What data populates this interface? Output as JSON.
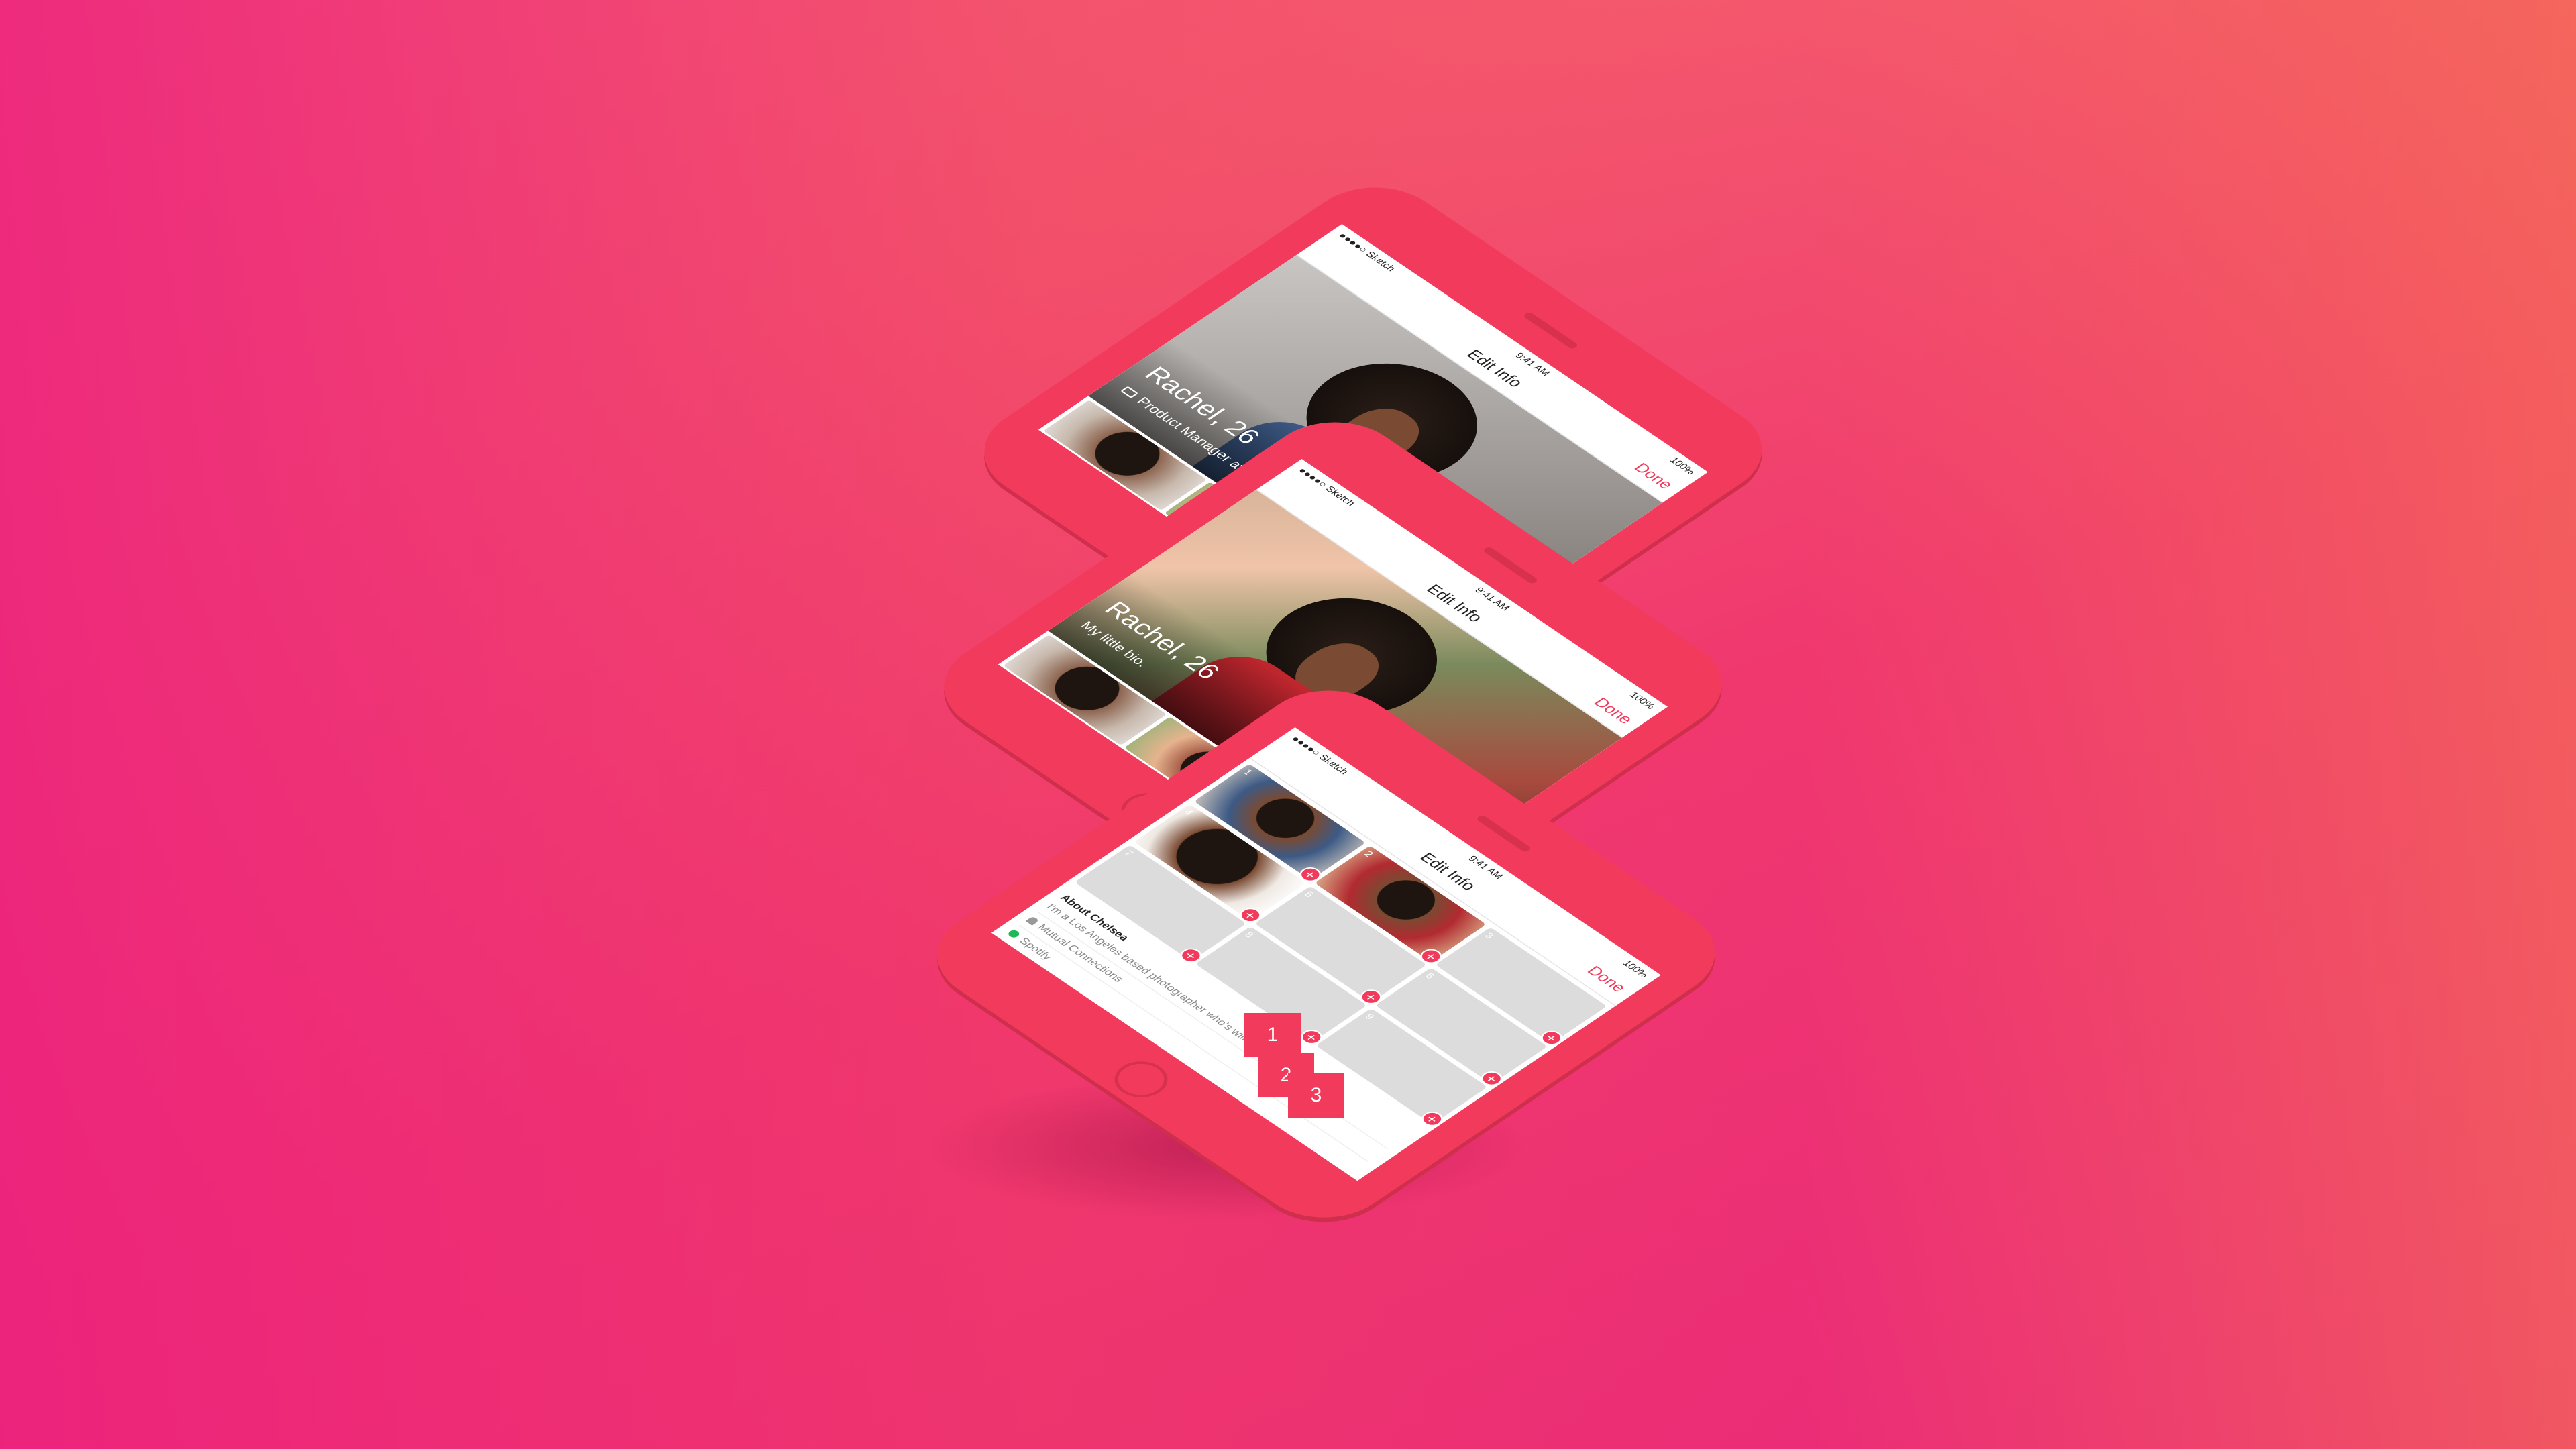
{
  "colors": {
    "accent": "#f23b5c",
    "bg_left": "#ec207e",
    "bg_right": "#f77d4e"
  },
  "phones": [
    {
      "status": {
        "carrier": "●●●●○ Sketch",
        "time": "9:41 AM",
        "battery": "100%"
      },
      "nav": {
        "title": "Edit Info",
        "action": "Done"
      },
      "profile": {
        "name": "Rachel, 26",
        "job": "Product Manager at Tinder"
      }
    },
    {
      "status": {
        "carrier": "●●●●○ Sketch",
        "time": "9:41 AM",
        "battery": "100%"
      },
      "nav": {
        "title": "Edit Info",
        "action": "Done"
      },
      "profile": {
        "name": "Rachel, 26",
        "job": "My little bio."
      }
    },
    {
      "status": {
        "carrier": "●●●●○ Sketch",
        "time": "9:41 AM",
        "battery": "100%"
      },
      "nav": {
        "title": "Edit Info",
        "action": "Done"
      },
      "slots": [
        "1",
        "2",
        "3",
        "4",
        "5",
        "6",
        "7",
        "8",
        "9"
      ],
      "add_glyph": "+",
      "about": {
        "label": "About Chelsea",
        "text": "I'm a Los Angeles based photographer who's willing to travel anywhere",
        "mutual": "Mutual Connections",
        "spotify": "Spotify"
      }
    }
  ],
  "badges": [
    "1",
    "2",
    "3"
  ]
}
